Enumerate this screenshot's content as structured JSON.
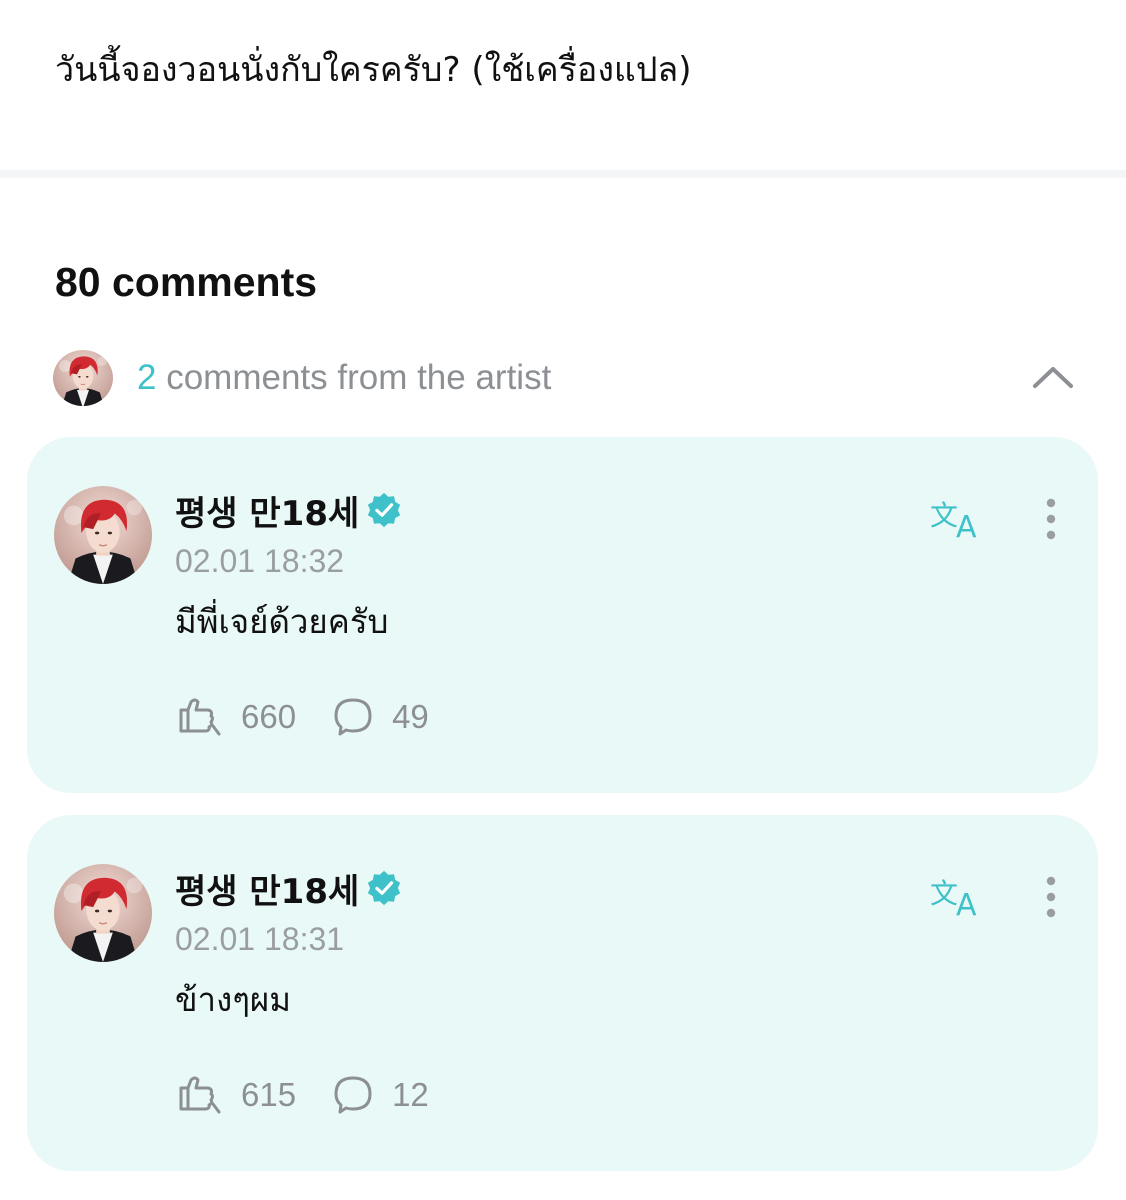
{
  "post": {
    "text": "วันนี้จองวอนนั่งกับใครครับ? (ใช้เครื่องแปล)"
  },
  "comments_header": {
    "count_label": "80 comments"
  },
  "artist_section": {
    "count": "2",
    "label": "comments from the artist",
    "collapse_icon": "chevron-up-icon"
  },
  "comments": [
    {
      "author": "평생 만18세",
      "verified": true,
      "timestamp": "02.01 18:32",
      "text": "มีพี่เจย์ด้วยครับ",
      "likes": "660",
      "replies": "49"
    },
    {
      "author": "평생 만18세",
      "verified": true,
      "timestamp": "02.01 18:31",
      "text": "ข้างๆผม",
      "likes": "615",
      "replies": "12"
    }
  ],
  "colors": {
    "accent": "#3fc1c9",
    "card_background": "#e9f9f7",
    "muted_text": "#8c8f93"
  }
}
